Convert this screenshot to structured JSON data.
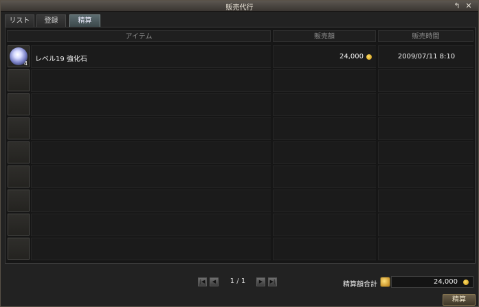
{
  "window": {
    "title": "販売代行",
    "restore_glyph": "↰",
    "close_glyph": "✕"
  },
  "tabs": [
    {
      "label": "リスト",
      "active": false
    },
    {
      "label": "登録",
      "active": false
    },
    {
      "label": "精算",
      "active": true
    }
  ],
  "table": {
    "columns": [
      "アイテム",
      "販売額",
      "販売時間"
    ],
    "rows": [
      {
        "item_icon": "orb-icon",
        "item_qty": "4",
        "item_name": "レベル19 強化石",
        "price": "24,000",
        "time": "2009/07/11 8:10"
      }
    ],
    "empty_row_count": 8
  },
  "pager": {
    "page_text": "1 / 1",
    "first_glyph": "|◀",
    "prev_glyph": "◀",
    "next_glyph": "▶",
    "last_glyph": "▶|"
  },
  "total": {
    "label": "精算額合計",
    "value": "24,000"
  },
  "settle_button": {
    "label": "精算"
  },
  "colors": {
    "coin": "#e0b83a",
    "active_tab": "#5c6c70"
  }
}
